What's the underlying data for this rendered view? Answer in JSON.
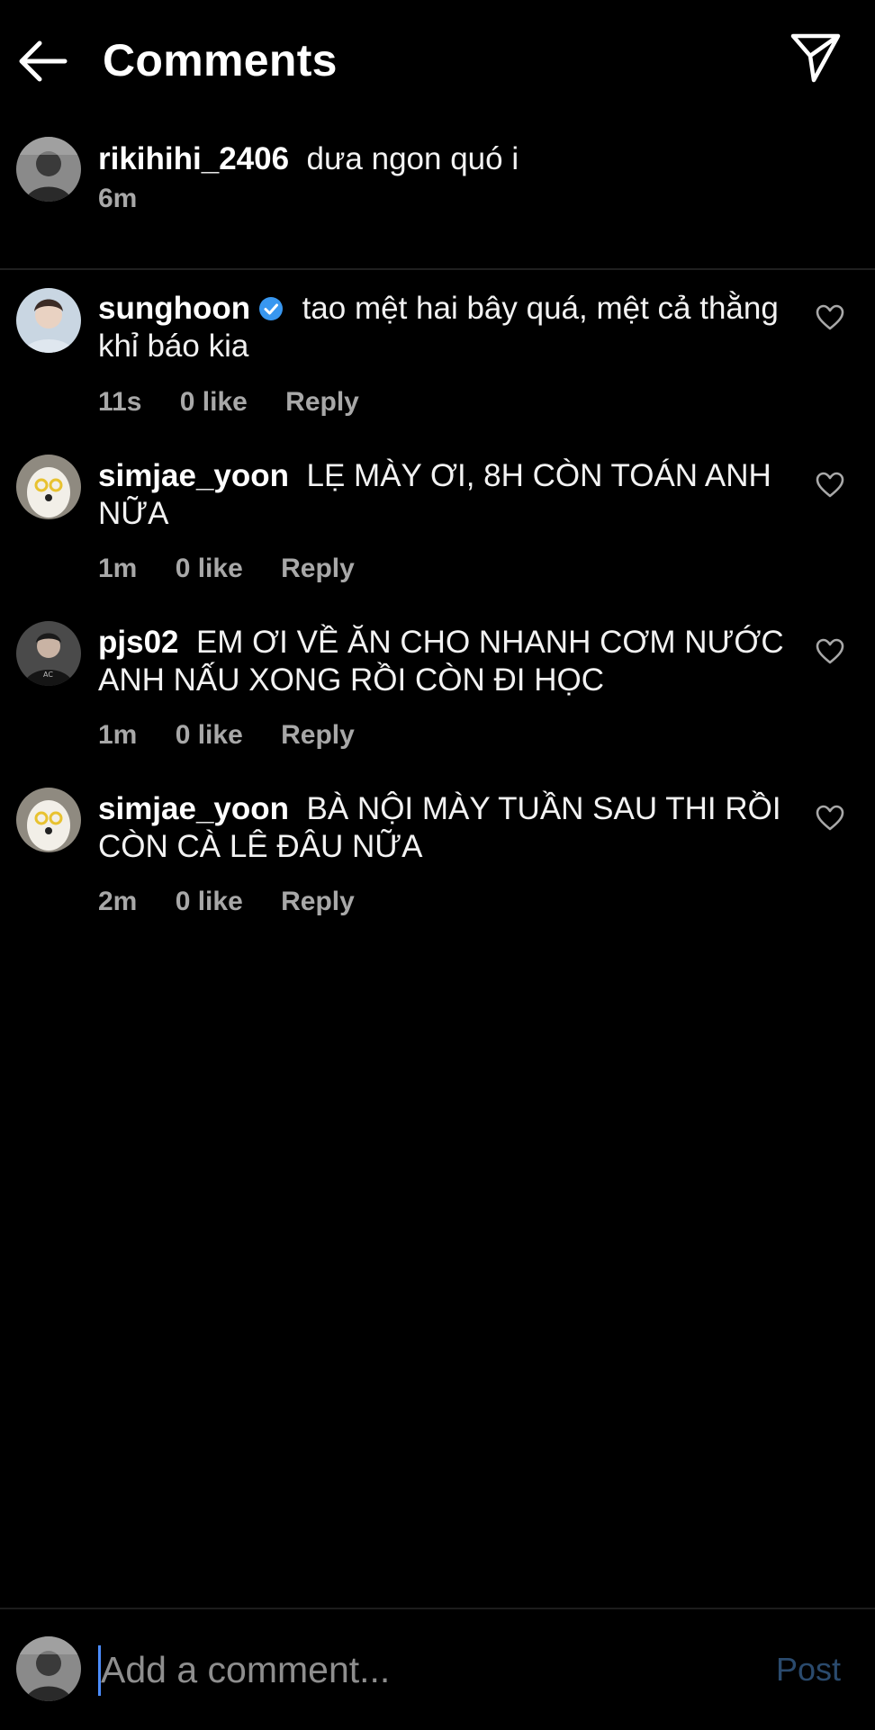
{
  "header": {
    "title": "Comments",
    "back_icon": "arrow-left-icon",
    "share_icon": "paper-plane-icon"
  },
  "caption": {
    "username": "rikihihi_2406",
    "text": "dưa ngon quó i",
    "time": "6m"
  },
  "comments": [
    {
      "username": "sunghoon",
      "verified": true,
      "text": "tao mệt hai bây quá, mệt cả thằng khỉ báo kia",
      "time": "11s",
      "likes": "0 like",
      "reply": "Reply"
    },
    {
      "username": "simjae_yoon",
      "verified": false,
      "text": "LẸ MÀY ƠI, 8H CÒN TOÁN ANH NỮA",
      "time": "1m",
      "likes": "0 like",
      "reply": "Reply"
    },
    {
      "username": "pjs02",
      "verified": false,
      "text": "EM ƠI VỀ ĂN CHO NHANH CƠM NƯỚC ANH NẤU XONG RỒI CÒN ĐI HỌC",
      "time": "1m",
      "likes": "0 like",
      "reply": "Reply"
    },
    {
      "username": "simjae_yoon",
      "verified": false,
      "text": "BÀ NỘI MÀY TUẦN SAU THI RỒI CÒN CÀ LÊ ĐÂU NỮA",
      "time": "2m",
      "likes": "0 like",
      "reply": "Reply"
    }
  ],
  "composer": {
    "placeholder": "Add a comment...",
    "post_label": "Post"
  },
  "colors": {
    "background": "#000000",
    "meta": "#a8a8a8",
    "verified": "#3897f0",
    "post": "#2a4a6d",
    "caret": "#4c8dff"
  }
}
